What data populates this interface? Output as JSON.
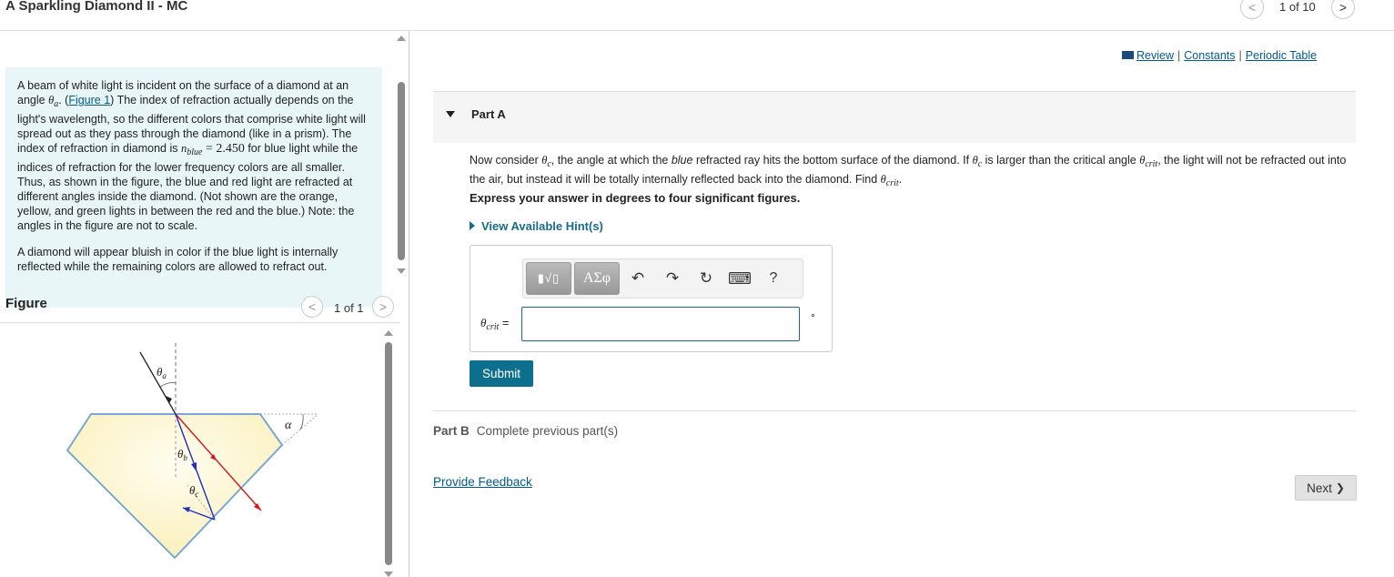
{
  "header": {
    "title": "A Sparkling Diamond II - MC",
    "pager": "1 of 10",
    "prev_glyph": "<",
    "next_glyph": ">"
  },
  "intro": {
    "para1_a": "A beam of white light is incident on the surface of a diamond at an angle ",
    "theta_a": "θ",
    "theta_a_sub": "a",
    "para1_b": ". (",
    "figure_link": "Figure 1",
    "para1_c": ") The index of refraction actually depends on the light's wavelength, so the different colors that comprise white light will spread out as they pass through the diamond (like in a prism). The index of refraction in diamond is ",
    "n_symbol": "n",
    "n_sub": "blue",
    "n_value": " = 2.450",
    "para1_d": " for blue light while the indices of refraction for the lower frequency colors are all smaller. Thus, as shown in the figure, the blue and red light are refracted at different angles inside the diamond. (Not shown are the orange, yellow, and green lights in between the red and the blue.) Note: the angles in the figure are not to scale.",
    "para2": "A diamond will appear bluish in color if the blue light is internally reflected while the remaining colors are allowed to refract out."
  },
  "figure": {
    "label": "Figure",
    "pager": "1 of 1",
    "theta_a_label": "θ",
    "theta_a_sub": "a",
    "theta_b_label": "θ",
    "theta_b_sub": "b",
    "theta_c_label": "θ",
    "theta_c_sub": "c",
    "alpha_label": "α"
  },
  "links": {
    "review": "Review",
    "constants": "Constants",
    "periodic": "Periodic Table",
    "sep": "|"
  },
  "partA": {
    "label": "Part A",
    "q_a": "Now consider ",
    "theta_c": "θ",
    "theta_c_sub": "c",
    "q_b": ", the angle at which the ",
    "q_blue": "blue",
    "q_c": " refracted ray hits the bottom surface of the diamond. If ",
    "q_d": " is larger than the critical angle ",
    "theta_crit": "θ",
    "theta_crit_sub": "crit",
    "q_e": ", the light will not be refracted out into the air, but instead it will be totally internally reflected back into the diamond. Find ",
    "q_f": ".",
    "instruction": "Express your answer in degrees to four significant figures.",
    "hint": "View Available Hint(s)",
    "toolbar": {
      "templates_glyph": "▮√▯",
      "greek_glyph": "ΑΣφ",
      "undo_glyph": "↶",
      "redo_glyph": "↷",
      "reset_glyph": "↻",
      "keyboard_glyph": "⌨",
      "help_glyph": "?"
    },
    "answer_label_sym": "θ",
    "answer_label_sub": "crit",
    "answer_label_eq": " =",
    "answer_value": "",
    "unit": "°",
    "submit": "Submit"
  },
  "partB": {
    "label": "Part B",
    "status": "Complete previous part(s)"
  },
  "footer": {
    "feedback": "Provide Feedback",
    "next": "Next",
    "next_glyph": "❯"
  },
  "colors": {
    "accent": "#0d6f8e",
    "intro_bg": "#e8f6f8",
    "blue_ray": "#1c2fbf",
    "red_ray": "#d0181c",
    "diamond_edge": "#7aa8d6"
  }
}
